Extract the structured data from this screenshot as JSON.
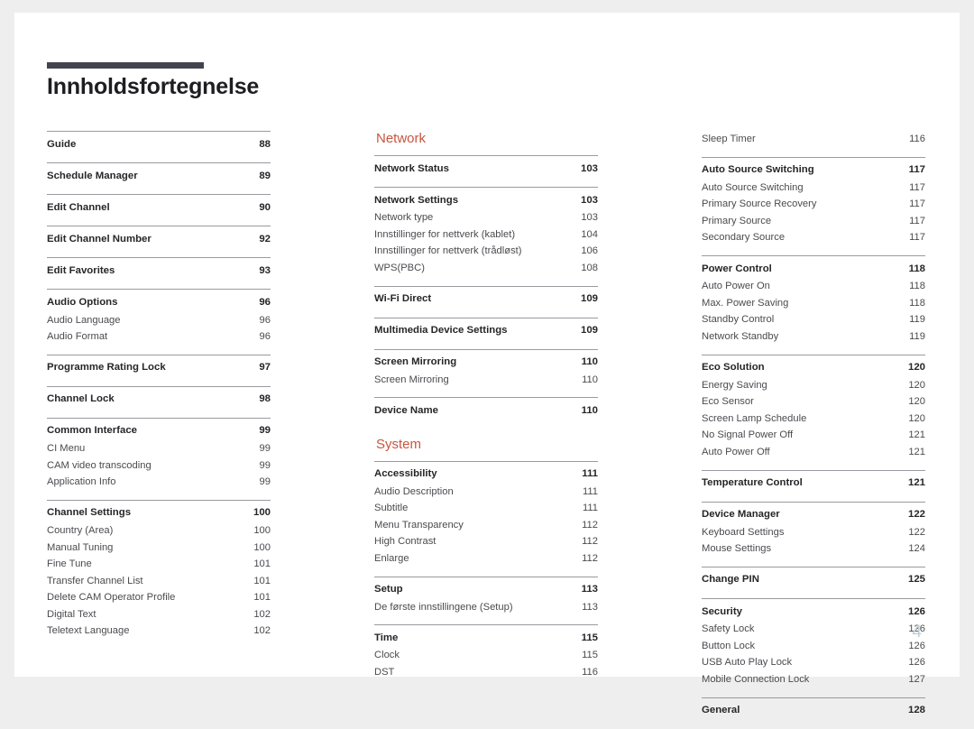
{
  "document": {
    "title": "Innholdsfortegnelse",
    "page_number": "4",
    "accent_color": "#c8553d",
    "rule_color": "#9a9aa0",
    "title_bar_color": "#43434f",
    "page_number_color": "#c2ced2"
  },
  "columns": [
    {
      "id": "column-1",
      "section_heading": null,
      "groups": [
        {
          "rule": true,
          "entries": [
            {
              "label": "Guide",
              "page": "88",
              "level": "head"
            }
          ]
        },
        {
          "rule": true,
          "entries": [
            {
              "label": "Schedule Manager",
              "page": "89",
              "level": "head"
            }
          ]
        },
        {
          "rule": true,
          "entries": [
            {
              "label": "Edit Channel",
              "page": "90",
              "level": "head"
            }
          ]
        },
        {
          "rule": true,
          "entries": [
            {
              "label": "Edit Channel Number",
              "page": "92",
              "level": "head"
            }
          ]
        },
        {
          "rule": true,
          "entries": [
            {
              "label": "Edit Favorites",
              "page": "93",
              "level": "head"
            }
          ]
        },
        {
          "rule": true,
          "entries": [
            {
              "label": "Audio Options",
              "page": "96",
              "level": "head"
            },
            {
              "label": "Audio Language",
              "page": "96",
              "level": "sub"
            },
            {
              "label": "Audio Format",
              "page": "96",
              "level": "sub"
            }
          ]
        },
        {
          "rule": true,
          "entries": [
            {
              "label": "Programme Rating Lock",
              "page": "97",
              "level": "head"
            }
          ]
        },
        {
          "rule": true,
          "entries": [
            {
              "label": "Channel Lock",
              "page": "98",
              "level": "head"
            }
          ]
        },
        {
          "rule": true,
          "entries": [
            {
              "label": "Common Interface",
              "page": "99",
              "level": "head"
            },
            {
              "label": "CI Menu",
              "page": "99",
              "level": "sub"
            },
            {
              "label": "CAM video transcoding",
              "page": "99",
              "level": "sub"
            },
            {
              "label": "Application Info",
              "page": "99",
              "level": "sub"
            }
          ]
        },
        {
          "rule": true,
          "entries": [
            {
              "label": "Channel Settings",
              "page": "100",
              "level": "head"
            },
            {
              "label": "Country (Area)",
              "page": "100",
              "level": "sub"
            },
            {
              "label": "Manual Tuning",
              "page": "100",
              "level": "sub"
            },
            {
              "label": "Fine Tune",
              "page": "101",
              "level": "sub"
            },
            {
              "label": "Transfer Channel List",
              "page": "101",
              "level": "sub"
            },
            {
              "label": "Delete CAM Operator Profile",
              "page": "101",
              "level": "sub"
            },
            {
              "label": "Digital Text",
              "page": "102",
              "level": "sub"
            },
            {
              "label": "Teletext Language",
              "page": "102",
              "level": "sub"
            }
          ]
        }
      ]
    },
    {
      "id": "column-2",
      "sections": [
        {
          "heading": "Network",
          "groups": [
            {
              "rule": true,
              "entries": [
                {
                  "label": "Network Status",
                  "page": "103",
                  "level": "head"
                }
              ]
            },
            {
              "rule": true,
              "entries": [
                {
                  "label": "Network Settings",
                  "page": "103",
                  "level": "head"
                },
                {
                  "label": "Network type",
                  "page": "103",
                  "level": "sub"
                },
                {
                  "label": "Innstillinger for nettverk (kablet)",
                  "page": "104",
                  "level": "sub"
                },
                {
                  "label": "Innstillinger for nettverk (trådløst)",
                  "page": "106",
                  "level": "sub"
                },
                {
                  "label": "WPS(PBC)",
                  "page": "108",
                  "level": "sub"
                }
              ]
            },
            {
              "rule": true,
              "entries": [
                {
                  "label": "Wi-Fi Direct",
                  "page": "109",
                  "level": "head"
                }
              ]
            },
            {
              "rule": true,
              "entries": [
                {
                  "label": "Multimedia Device Settings",
                  "page": "109",
                  "level": "head"
                }
              ]
            },
            {
              "rule": true,
              "entries": [
                {
                  "label": "Screen Mirroring",
                  "page": "110",
                  "level": "head"
                },
                {
                  "label": "Screen Mirroring",
                  "page": "110",
                  "level": "sub"
                }
              ]
            },
            {
              "rule": true,
              "entries": [
                {
                  "label": "Device Name",
                  "page": "110",
                  "level": "head"
                }
              ]
            }
          ]
        },
        {
          "heading": "System",
          "groups": [
            {
              "rule": true,
              "entries": [
                {
                  "label": "Accessibility",
                  "page": "111",
                  "level": "head"
                },
                {
                  "label": "Audio Description",
                  "page": "111",
                  "level": "sub"
                },
                {
                  "label": "Subtitle",
                  "page": "111",
                  "level": "sub"
                },
                {
                  "label": "Menu Transparency",
                  "page": "112",
                  "level": "sub"
                },
                {
                  "label": "High Contrast",
                  "page": "112",
                  "level": "sub"
                },
                {
                  "label": "Enlarge",
                  "page": "112",
                  "level": "sub"
                }
              ]
            },
            {
              "rule": true,
              "entries": [
                {
                  "label": "Setup",
                  "page": "113",
                  "level": "head"
                },
                {
                  "label": "De første innstillingene (Setup)",
                  "page": "113",
                  "level": "sub"
                }
              ]
            },
            {
              "rule": true,
              "entries": [
                {
                  "label": "Time",
                  "page": "115",
                  "level": "head"
                },
                {
                  "label": "Clock",
                  "page": "115",
                  "level": "sub"
                },
                {
                  "label": "DST",
                  "page": "116",
                  "level": "sub"
                }
              ]
            }
          ]
        }
      ]
    },
    {
      "id": "column-3",
      "section_heading": null,
      "groups": [
        {
          "rule": false,
          "entries": [
            {
              "label": "Sleep Timer",
              "page": "116",
              "level": "sub"
            }
          ]
        },
        {
          "rule": true,
          "entries": [
            {
              "label": "Auto Source Switching",
              "page": "117",
              "level": "head"
            },
            {
              "label": "Auto Source Switching",
              "page": "117",
              "level": "sub"
            },
            {
              "label": "Primary Source Recovery",
              "page": "117",
              "level": "sub"
            },
            {
              "label": "Primary Source",
              "page": "117",
              "level": "sub"
            },
            {
              "label": "Secondary Source",
              "page": "117",
              "level": "sub"
            }
          ]
        },
        {
          "rule": true,
          "entries": [
            {
              "label": "Power Control",
              "page": "118",
              "level": "head"
            },
            {
              "label": "Auto Power On",
              "page": "118",
              "level": "sub"
            },
            {
              "label": "Max. Power Saving",
              "page": "118",
              "level": "sub"
            },
            {
              "label": "Standby Control",
              "page": "119",
              "level": "sub"
            },
            {
              "label": "Network Standby",
              "page": "119",
              "level": "sub"
            }
          ]
        },
        {
          "rule": true,
          "entries": [
            {
              "label": "Eco Solution",
              "page": "120",
              "level": "head"
            },
            {
              "label": "Energy Saving",
              "page": "120",
              "level": "sub"
            },
            {
              "label": "Eco Sensor",
              "page": "120",
              "level": "sub"
            },
            {
              "label": "Screen Lamp Schedule",
              "page": "120",
              "level": "sub"
            },
            {
              "label": "No Signal Power Off",
              "page": "121",
              "level": "sub"
            },
            {
              "label": "Auto Power Off",
              "page": "121",
              "level": "sub"
            }
          ]
        },
        {
          "rule": true,
          "entries": [
            {
              "label": "Temperature Control",
              "page": "121",
              "level": "head"
            }
          ]
        },
        {
          "rule": true,
          "entries": [
            {
              "label": "Device Manager",
              "page": "122",
              "level": "head"
            },
            {
              "label": "Keyboard Settings",
              "page": "122",
              "level": "sub"
            },
            {
              "label": "Mouse Settings",
              "page": "124",
              "level": "sub"
            }
          ]
        },
        {
          "rule": true,
          "entries": [
            {
              "label": "Change PIN",
              "page": "125",
              "level": "head"
            }
          ]
        },
        {
          "rule": true,
          "entries": [
            {
              "label": "Security",
              "page": "126",
              "level": "head"
            },
            {
              "label": "Safety Lock",
              "page": "126",
              "level": "sub"
            },
            {
              "label": "Button Lock",
              "page": "126",
              "level": "sub"
            },
            {
              "label": "USB Auto Play Lock",
              "page": "126",
              "level": "sub"
            },
            {
              "label": "Mobile Connection Lock",
              "page": "127",
              "level": "sub"
            }
          ]
        },
        {
          "rule": true,
          "entries": [
            {
              "label": "General",
              "page": "128",
              "level": "head"
            }
          ]
        }
      ]
    }
  ]
}
